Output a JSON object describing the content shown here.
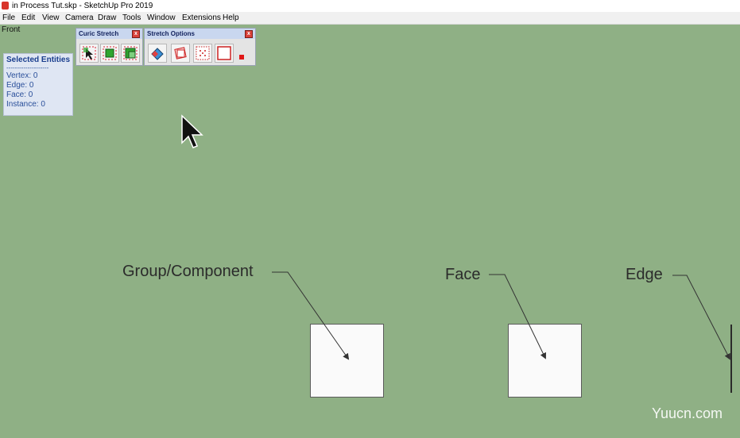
{
  "window": {
    "title": "in Process Tut.skp - SketchUp Pro 2019"
  },
  "menu": [
    "File",
    "Edit",
    "View",
    "Camera",
    "Draw",
    "Tools",
    "Window",
    "Extensions",
    "Help"
  ],
  "viewport": {
    "view_label": "Front",
    "background": "#8fb085"
  },
  "toolbars": {
    "curic_stretch": {
      "title": "Curic Stretch",
      "close": "x"
    },
    "stretch_options": {
      "title": "Stretch Options",
      "close": "x"
    }
  },
  "entities_panel": {
    "title": "Selected Entities",
    "divider": "--------------------",
    "rows": [
      "Vertex: 0",
      "Edge: 0",
      "Face: 0",
      "Instance: 0"
    ]
  },
  "callouts": {
    "group": "Group/Component",
    "face": "Face",
    "edge": "Edge"
  },
  "watermark": "Yuucn.com"
}
